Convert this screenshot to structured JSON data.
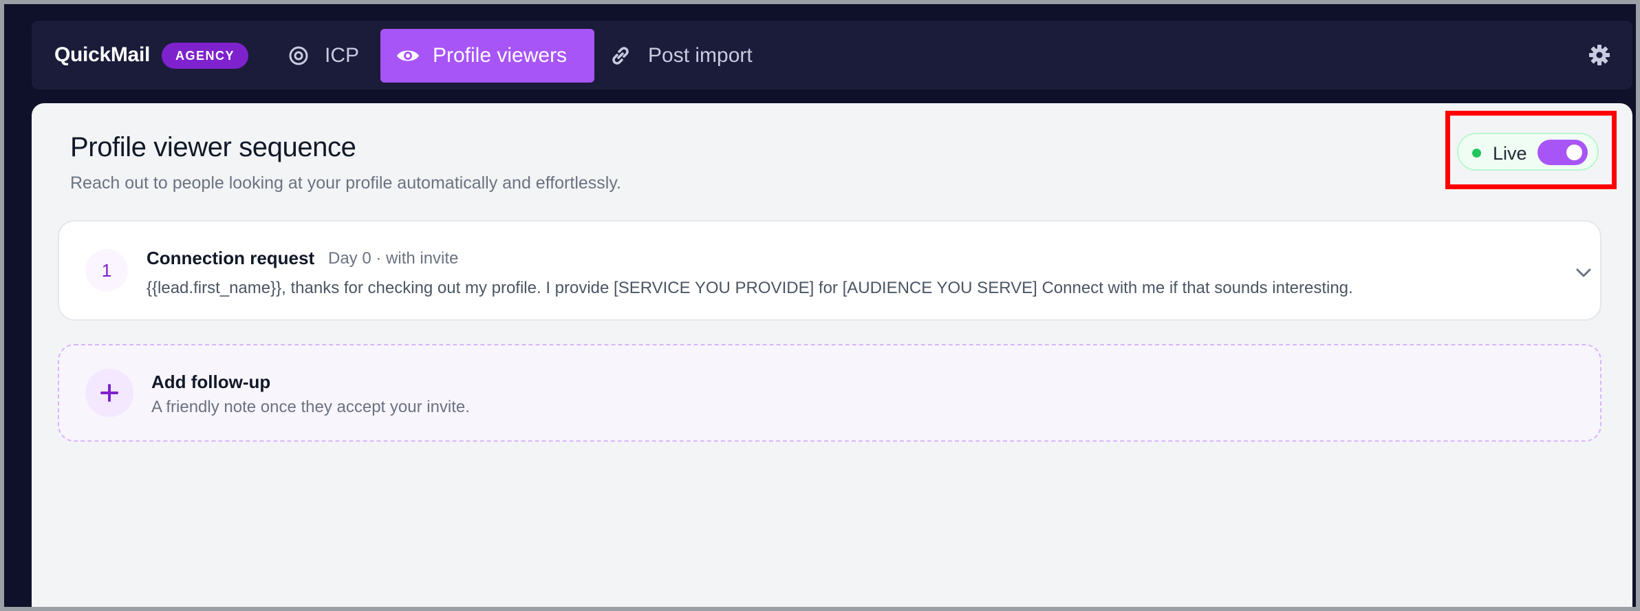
{
  "nav": {
    "brand": "QuickMail",
    "badge": "AGENCY",
    "tabs": [
      {
        "label": "ICP",
        "icon": "target-icon",
        "active": false
      },
      {
        "label": "Profile viewers",
        "icon": "eye-icon",
        "active": true
      },
      {
        "label": "Post import",
        "icon": "link-icon",
        "active": false
      }
    ],
    "settings_icon": "gear-icon"
  },
  "main": {
    "title": "Profile viewer sequence",
    "subtitle": "Reach out to people looking at your profile automatically and effortlessly.",
    "status": {
      "label": "Live",
      "enabled": true,
      "dot_color": "#22c55e"
    },
    "steps": [
      {
        "number": "1",
        "title": "Connection request",
        "meta": "Day 0 · with invite",
        "body": "{{lead.first_name}}, thanks for checking out my profile. I provide [SERVICE YOU PROVIDE] for [AUDIENCE YOU SERVE] Connect with me if that sounds interesting."
      }
    ],
    "add_followup": {
      "title": "Add follow-up",
      "subtitle": "A friendly note once they accept your invite."
    }
  },
  "colors": {
    "accent": "#a855f7",
    "badge": "#7e22ce",
    "nav_bg": "#1b1c3a",
    "page_bg": "#0f1029",
    "highlight": "#ff0000"
  }
}
